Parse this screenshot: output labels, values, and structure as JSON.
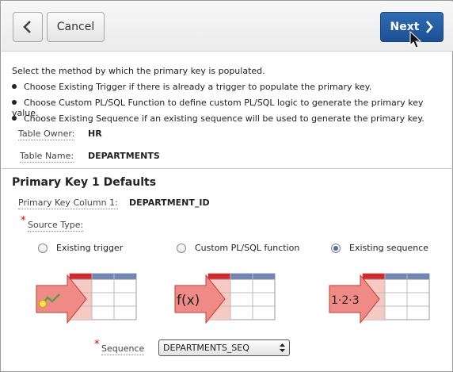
{
  "toolbar": {
    "back_icon": "chevron-left-icon",
    "cancel_label": "Cancel",
    "next_label": "Next",
    "next_icon": "chevron-right-icon"
  },
  "help": {
    "intro": "Select the method by which the primary key is populated.",
    "bullets": [
      "Choose Existing Trigger if there is already a trigger to populate the primary key.",
      "Choose Custom PL/SQL Function to define custom PL/SQL logic to generate the primary key value.",
      "Choose Existing Sequence if an existing sequence will be used to generate the primary key."
    ]
  },
  "table": {
    "owner_label": "Table Owner:",
    "owner_value": "HR",
    "name_label": "Table Name:",
    "name_value": "DEPARTMENTS"
  },
  "section": {
    "title": "Primary Key 1 Defaults",
    "pk_label": "Primary Key Column 1:",
    "pk_value": "DEPARTMENT_ID",
    "required_mark": "*",
    "source_label": "Source Type:",
    "options": [
      {
        "label": "Existing trigger",
        "selected": false,
        "icon": "trigger-table-icon"
      },
      {
        "label": "Custom PL/SQL function",
        "selected": false,
        "icon": "function-table-icon",
        "glyph": "f(x)"
      },
      {
        "label": "Existing sequence",
        "selected": true,
        "icon": "sequence-table-icon",
        "glyph": "1·2·3"
      }
    ],
    "sequence_label": "Sequence",
    "sequence_value": "DEPARTMENTS_SEQ"
  },
  "colors": {
    "accent": "#1f5699",
    "required": "#dd0000",
    "arrow": "#f08a86",
    "table_header_red": "#d8262b",
    "table_header_blue": "#6e87b8"
  }
}
